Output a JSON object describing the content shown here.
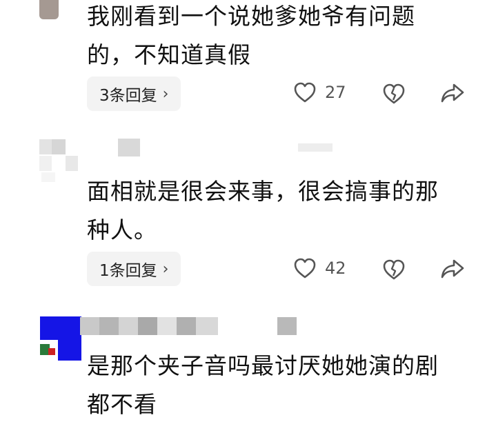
{
  "comments": [
    {
      "text_line1": "我刚看到一个说她爹她爷有问题",
      "text_line2": "的，不知道真假",
      "reply_label": "3条回复",
      "likes": "27"
    },
    {
      "text_line1": "面相就是很会来事，很会搞事的那",
      "text_line2": "种人。",
      "reply_label": "1条回复",
      "likes": "42"
    },
    {
      "text_line1": "是那个夹子音吗最讨厌她她演的剧",
      "text_line2": "都不看"
    }
  ],
  "icons": {
    "like": "heart-outline-icon",
    "dislike": "broken-heart-icon",
    "share": "share-arrow-icon",
    "reply_chevron": "chevron-right-icon"
  },
  "colors": {
    "text": "#111111",
    "meta": "#555555",
    "pill_bg": "#f3f3f3",
    "avatar_blue": "#1515e6"
  }
}
